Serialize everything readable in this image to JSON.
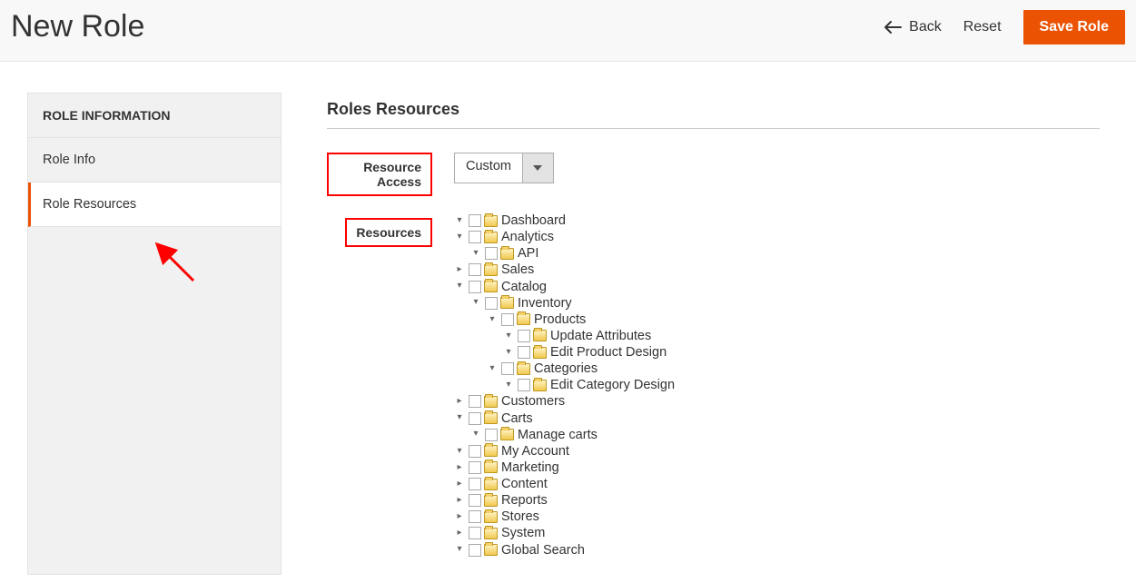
{
  "header": {
    "title": "New Role",
    "back_label": "Back",
    "reset_label": "Reset",
    "save_label": "Save Role"
  },
  "sidebar": {
    "title": "ROLE INFORMATION",
    "items": [
      {
        "label": "Role Info",
        "active": false
      },
      {
        "label": "Role Resources",
        "active": true
      }
    ]
  },
  "main": {
    "section_title": "Roles Resources",
    "resource_access_label": "Resource Access",
    "resources_label": "Resources",
    "select_value": "Custom"
  },
  "tree": {
    "dashboard": "Dashboard",
    "analytics": "Analytics",
    "api": "API",
    "sales": "Sales",
    "catalog": "Catalog",
    "inventory": "Inventory",
    "products": "Products",
    "update_attributes": "Update Attributes",
    "edit_product_design": "Edit Product Design",
    "categories": "Categories",
    "edit_category_design": "Edit Category Design",
    "customers": "Customers",
    "carts": "Carts",
    "manage_carts": "Manage carts",
    "my_account": "My Account",
    "marketing": "Marketing",
    "content": "Content",
    "reports": "Reports",
    "stores": "Stores",
    "system": "System",
    "global_search": "Global Search"
  }
}
